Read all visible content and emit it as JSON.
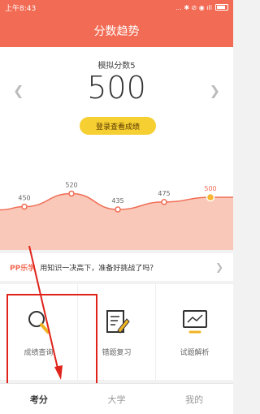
{
  "status_bar": {
    "time": "上午8:43",
    "icons": "... ✱ ⊘ ◉ ıll"
  },
  "header": {
    "title": "分数趋势"
  },
  "score": {
    "exam_label": "模拟分数5",
    "value": "500",
    "prev_icon": "chevron-left-icon",
    "next_icon": "chevron-right-icon",
    "login_button": "登录查看成绩"
  },
  "chart_data": {
    "type": "area",
    "x": [
      1,
      2,
      3,
      4,
      5
    ],
    "values": [
      450,
      520,
      435,
      475,
      500
    ],
    "labels": [
      "450",
      "520",
      "435",
      "475",
      "500"
    ],
    "highlight_index": 4,
    "colors": {
      "fill": "#f9c8b8",
      "line": "#f06d55",
      "highlight": "#f7b733",
      "label": "#f06d55"
    }
  },
  "promo": {
    "logo_pp": "PP",
    "logo_text": "乐学",
    "text": "用知识一决高下，准备好挑战了吗？"
  },
  "features": [
    {
      "label": "成绩查询",
      "icon": "magnifier-icon"
    },
    {
      "label": "错题复习",
      "icon": "edit-note-icon"
    },
    {
      "label": "试题解析",
      "icon": "chart-board-icon"
    }
  ],
  "tabs": [
    {
      "label": "考分",
      "active": true
    },
    {
      "label": "大学",
      "active": false
    },
    {
      "label": "我的",
      "active": false
    }
  ],
  "colors": {
    "brand": "#f26b54",
    "annotation": "#e0231a"
  }
}
